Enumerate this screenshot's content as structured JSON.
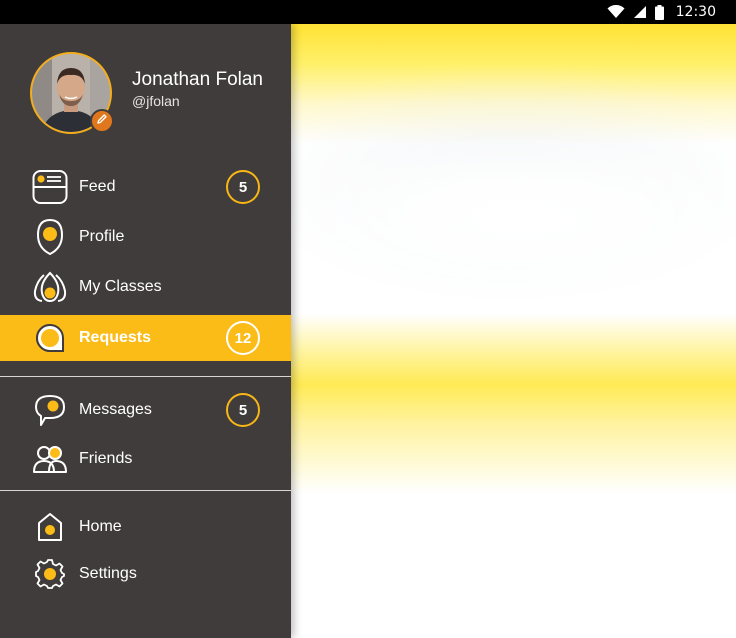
{
  "status_bar": {
    "time": "12:30",
    "icons": [
      "wifi-icon",
      "cell-signal-icon",
      "battery-icon"
    ]
  },
  "colors": {
    "drawer_bg": "#403c3b",
    "accent": "#fbbc17",
    "edit_badge": "#e1771c"
  },
  "profile": {
    "name": "Jonathan Folan",
    "handle": "@jfolan"
  },
  "nav": {
    "feed": {
      "label": "Feed",
      "badge": "5",
      "icon": "feed-icon"
    },
    "profile": {
      "label": "Profile",
      "icon": "profile-pin-icon"
    },
    "classes": {
      "label": "My Classes",
      "icon": "classes-icon"
    },
    "requests": {
      "label": "Requests",
      "badge": "12",
      "icon": "request-bubble-icon",
      "active": true
    },
    "messages": {
      "label": "Messages",
      "badge": "5",
      "icon": "message-bubble-icon"
    },
    "friends": {
      "label": "Friends",
      "icon": "friends-icon"
    },
    "home": {
      "label": "Home",
      "icon": "home-icon"
    },
    "settings": {
      "label": "Settings",
      "icon": "gear-icon"
    }
  }
}
